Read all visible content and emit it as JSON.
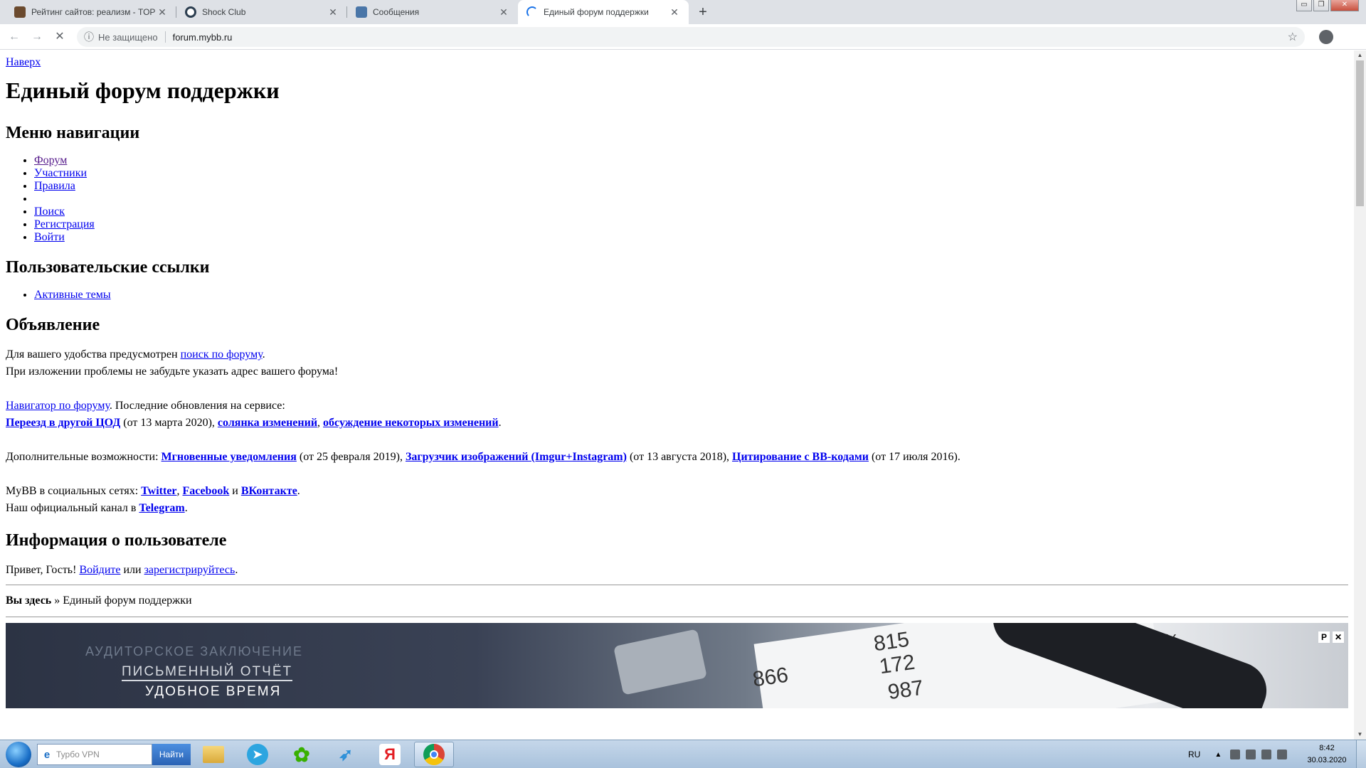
{
  "browser": {
    "tabs": [
      {
        "title": "Рейтинг сайтов: реализм - TOP",
        "favicon": "animal-favicon",
        "active": false
      },
      {
        "title": "Shock Club",
        "favicon": "circle-favicon",
        "active": false
      },
      {
        "title": "Сообщения",
        "favicon": "chat-favicon",
        "active": false
      },
      {
        "title": "Единый форум поддержки",
        "favicon": "loading-spinner",
        "active": true
      }
    ],
    "tab_close": "✕",
    "new_tab": "+",
    "window_controls": [
      "▭",
      "❐",
      "✕"
    ],
    "nav": {
      "back": "←",
      "forward": "→",
      "stop": "✕"
    },
    "security_icon": "ⓘ",
    "security_label": "Не защищено",
    "url": "forum.mybb.ru",
    "star": "☆",
    "menu": "⋮"
  },
  "page": {
    "top_link": "Наверх",
    "forum_title": "Единый форум поддержки",
    "nav_heading": "Меню навигации",
    "nav_items": [
      "Форум",
      "Участники",
      "Правила",
      "",
      "Поиск",
      "Регистрация",
      "Войти"
    ],
    "user_links_heading": "Пользовательские ссылки",
    "user_links": [
      "Активные темы"
    ],
    "announcement_heading": "Объявление",
    "announcement": {
      "l1_text": "Для вашего удобства предусмотрен ",
      "l1_link": "поиск по форуму",
      "l1_end": ".",
      "l2": "При изложении проблемы не забудьте указать адрес вашего форума!",
      "l3_link": "Навигатор по форуму",
      "l3_text": ". Последние обновления на сервисе:",
      "l4_link1": "Переезд в другой ЦОД",
      "l4_text1": " (от 13 марта 2020), ",
      "l4_link2": "солянка изменений",
      "l4_text2": ", ",
      "l4_link3": "обсуждение некоторых изменений",
      "l4_end": ".",
      "l5_text": "Дополнительные возможности: ",
      "l5_link1": "Мгновенные уведомления",
      "l5_text1": " (от 25 февраля 2019), ",
      "l5_link2": "Загрузчик изображений (Imgur+Instagram)",
      "l5_text2": " (от 13 августа 2018), ",
      "l5_link3": "Цитирование с BB-кодами",
      "l5_text3": " (от 17 июля 2016).",
      "l6_text": "MyBB в социальных сетях: ",
      "l6_link1": "Twitter",
      "l6_sep1": ", ",
      "l6_link2": "Facebook",
      "l6_sep2": " и ",
      "l6_link3": "ВКонтакте",
      "l6_end": ".",
      "l7_text": "Наш официальный канал в ",
      "l7_link": "Telegram",
      "l7_end": "."
    },
    "user_info_heading": "Информация о пользователе",
    "greeting": "Привет, Гость! ",
    "login_link": "Войдите",
    "or_text": " или ",
    "register_link": "зарегистрируйтесь",
    "greeting_end": ".",
    "breadcrumb_label": "Вы здесь",
    "breadcrumb_sep": " » ",
    "breadcrumb_current": "Единый форум поддержки",
    "banner": {
      "line1": "АУДИТОРСКОЕ ЗАКЛЮЧЕНИЕ",
      "line2": "ПИСЬМЕННЫЙ ОТЧЁТ",
      "line3": "УДОБНОЕ ВРЕМЯ",
      "numbers": [
        "815",
        "172",
        "987",
        "866",
        "1%"
      ],
      "ctrl_p": "P",
      "ctrl_close": "✕"
    }
  },
  "taskbar": {
    "search_placeholder": "Турбо VPN",
    "search_ie": "e",
    "search_button": "Найти",
    "apps": [
      "folder-icon",
      "telegram-icon",
      "icq-icon",
      "bird-icon",
      "yandex-icon",
      "chrome-icon"
    ],
    "yandex_letter": "Я",
    "language": "RU",
    "time": "8:42",
    "date": "30.03.2020"
  },
  "colors": {
    "link": "#0000ee",
    "visited": "#551a8b",
    "tab_strip": "#dee1e6",
    "taskbar": "#b8cde5"
  }
}
